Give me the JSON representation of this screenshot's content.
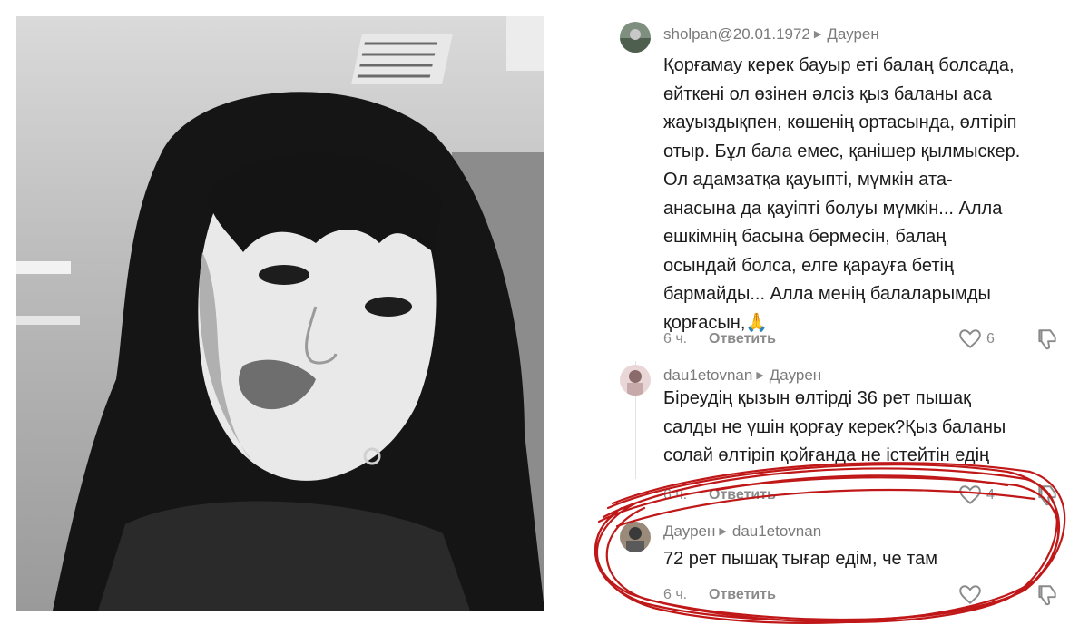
{
  "comments": [
    {
      "user": "sholpan@20.01.1972",
      "reply_to": "Даурен",
      "text": "Қорғамау керек бауыр еті балаң болсада,\nөйткені ол өзінен әлсіз қыз баланы аса\nжауыздықпен, көшенің ортасында, өлтіріп\nотыр. Бұл бала емес, қанішер қылмыскер.\nОл адамзатқа қауыпті, мүмкін ата-\nанасына да қауіпті болуы мүмкін... Алла\nешкімнің басына бермесін, балаң\nосындай болса, елге қарауға бетің\nбармайды... Алла менің балаларымды\nқорғасын,🙏",
      "time": "6 ч.",
      "reply_label": "Ответить",
      "likes": "6"
    },
    {
      "user": "dau1etovnan",
      "reply_to": "Даурен",
      "text": "Біреудің қызын өлтірді 36 рет пышақ\nсалды не үшін қорғау керек?Қыз баланы\nсолай өлтіріп қойғанда не істейтін едің",
      "time": "6 ч.",
      "reply_label": "Ответить",
      "likes": "4"
    },
    {
      "user": "Даурен",
      "reply_to": "dau1etovnan",
      "text": "72 рет пышақ тығар едім, че там",
      "time": "6 ч.",
      "reply_label": "Ответить",
      "likes": ""
    }
  ],
  "icons": {
    "arrow": "▶",
    "like": "heart-outline-icon",
    "dislike": "thumb-down-outline-icon"
  },
  "colors": {
    "annotation": "#c01818",
    "meta_text": "#7a7a7a"
  }
}
